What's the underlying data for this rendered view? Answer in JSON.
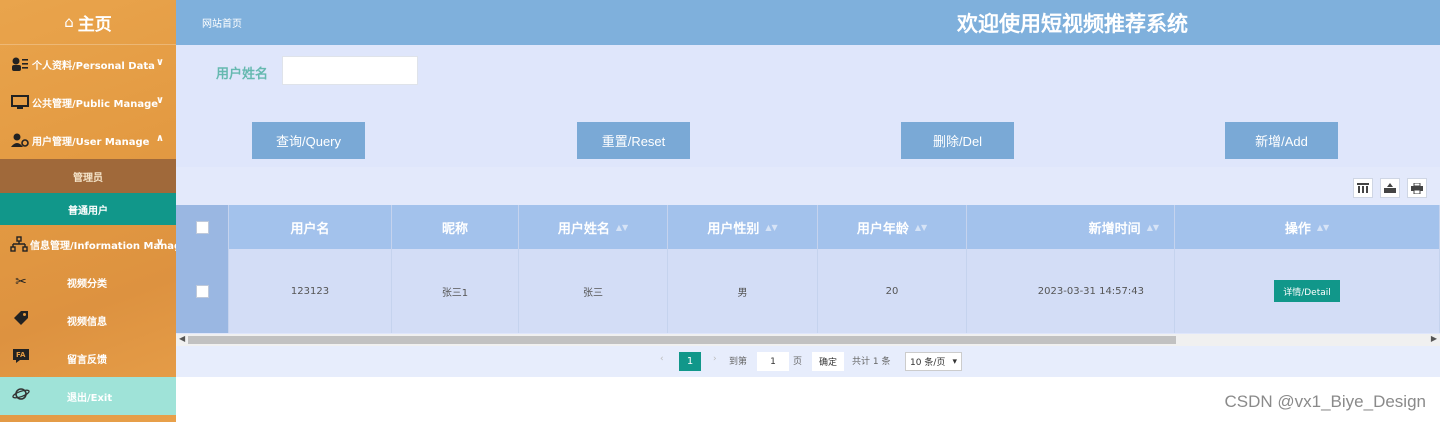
{
  "sidebar": {
    "home": "主页",
    "items": [
      {
        "label": "个人资料/Personal Data"
      },
      {
        "label": "公共管理/Public Manage"
      },
      {
        "label": "用户管理/User Manage"
      }
    ],
    "sub_items": [
      {
        "label": "管理员"
      },
      {
        "label": "普通用户"
      }
    ],
    "info_item": {
      "label": "信息管理/Information Manage"
    },
    "info_sub": [
      {
        "label": "视频分类"
      },
      {
        "label": "视频信息"
      },
      {
        "label": "留言反馈"
      }
    ],
    "exit": "退出/Exit"
  },
  "header": {
    "crumb": "网站首页",
    "title": "欢迎使用短视频推荐系统"
  },
  "search": {
    "label": "用户姓名",
    "placeholder": ""
  },
  "buttons": {
    "query": "查询/Query",
    "reset": "重置/Reset",
    "delete": "删除/Del",
    "add": "新增/Add"
  },
  "table": {
    "columns": [
      "用户名",
      "昵称",
      "用户姓名",
      "用户性别",
      "用户年龄",
      "新增时间",
      "操作"
    ],
    "rows": [
      {
        "username": "123123",
        "nickname": "张三1",
        "realname": "张三",
        "gender": "男",
        "age": "20",
        "created": "2023-03-31 14:57:43",
        "action": "详情/Detail"
      }
    ]
  },
  "pagination": {
    "current": "1",
    "goto_prefix": "到第",
    "goto_value": "1",
    "page_suffix": "页",
    "confirm": "确定",
    "total": "共计 1 条",
    "page_size": "10 条/页"
  },
  "watermark": "CSDN @vx1_Biye_Design"
}
